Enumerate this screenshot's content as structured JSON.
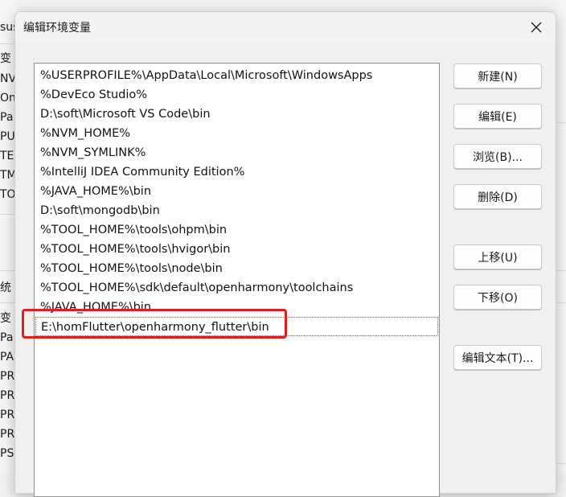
{
  "background": {
    "fragments": [
      "sus",
      "变",
      "NV",
      "On",
      "Pa",
      "PU",
      "TE",
      "TM",
      "TO",
      "统",
      "变",
      "Pa",
      "PA",
      "PR",
      "PR",
      "PR",
      "PR",
      "PS"
    ]
  },
  "dialog": {
    "title": "编辑环境变量",
    "close_icon": "close-icon",
    "entries": [
      "%USERPROFILE%\\AppData\\Local\\Microsoft\\WindowsApps",
      "%DevEco Studio%",
      "D:\\soft\\Microsoft VS Code\\bin",
      "%NVM_HOME%",
      "%NVM_SYMLINK%",
      "%IntelliJ IDEA Community Edition%",
      "%JAVA_HOME%\\bin",
      "D:\\soft\\mongodb\\bin",
      "%TOOL_HOME%\\tools\\ohpm\\bin",
      "%TOOL_HOME%\\tools\\hvigor\\bin",
      "%TOOL_HOME%\\tools\\node\\bin",
      "%TOOL_HOME%\\sdk\\default\\openharmony\\toolchains",
      "%JAVA_HOME%\\bin",
      "E:\\homFlutter\\openharmony_flutter\\bin"
    ],
    "selected_index": 13,
    "buttons": {
      "new": "新建(N)",
      "edit": "编辑(E)",
      "browse": "浏览(B)...",
      "delete": "删除(D)",
      "move_up": "上移(U)",
      "move_down": "下移(O)",
      "edit_text": "编辑文本(T)..."
    },
    "highlight_color": "#e02020"
  }
}
